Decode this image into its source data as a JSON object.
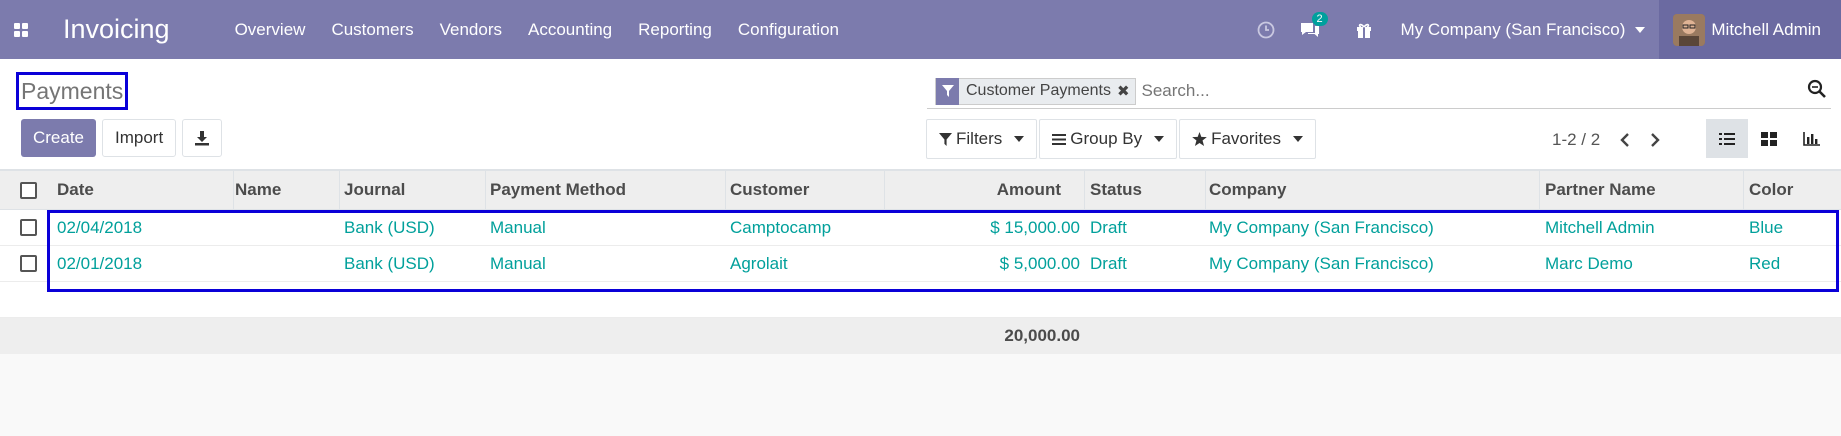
{
  "navbar": {
    "app_title": "Invoicing",
    "menu": [
      "Overview",
      "Customers",
      "Vendors",
      "Accounting",
      "Reporting",
      "Configuration"
    ],
    "messages_count": "2",
    "company": "My Company (San Francisco)",
    "user": "Mitchell Admin",
    "color": "#7c7bad"
  },
  "control_panel": {
    "title": "Payments",
    "create_label": "Create",
    "import_label": "Import",
    "search": {
      "facet": "Customer Payments",
      "placeholder": "Search..."
    },
    "filters_label": "Filters",
    "group_by_label": "Group By",
    "favorites_label": "Favorites",
    "pager": "1-2 / 2"
  },
  "table": {
    "columns": [
      "Date",
      "Name",
      "Journal",
      "Payment Method",
      "Customer",
      "Amount",
      "Status",
      "Company",
      "Partner Name",
      "Color"
    ],
    "rows": [
      {
        "date": "02/04/2018",
        "name": "",
        "journal": "Bank (USD)",
        "method": "Manual",
        "customer": "Camptocamp",
        "amount": "$ 15,000.00",
        "status": "Draft",
        "company": "My Company (San Francisco)",
        "partner": "Mitchell Admin",
        "color": "Blue"
      },
      {
        "date": "02/01/2018",
        "name": "",
        "journal": "Bank (USD)",
        "method": "Manual",
        "customer": "Agrolait",
        "amount": "$ 5,000.00",
        "status": "Draft",
        "company": "My Company (San Francisco)",
        "partner": "Marc Demo",
        "color": "Red"
      }
    ],
    "total": "20,000.00",
    "link_color": "#01a09b"
  }
}
